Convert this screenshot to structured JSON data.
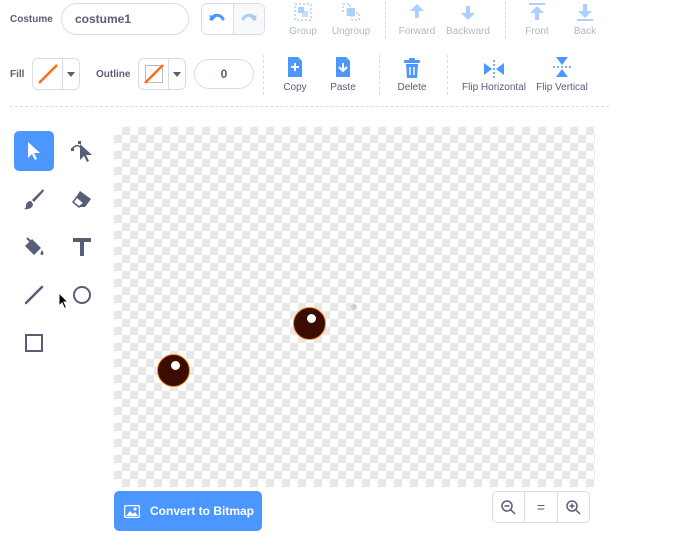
{
  "costume": {
    "label": "Costume",
    "name": "costume1"
  },
  "toolbar": {
    "group": "Group",
    "ungroup": "Ungroup",
    "forward": "Forward",
    "backward": "Backward",
    "front": "Front",
    "back": "Back",
    "copy": "Copy",
    "paste": "Paste",
    "delete": "Delete",
    "flip_horizontal": "Flip Horizontal",
    "flip_vertical": "Flip Vertical"
  },
  "fill": {
    "label": "Fill",
    "color": "#ff6b1a"
  },
  "outline": {
    "label": "Outline",
    "width": "0"
  },
  "tools": [
    {
      "name": "select",
      "icon": "arrow-select-icon",
      "active": true
    },
    {
      "name": "reshape",
      "icon": "reshape-icon",
      "active": false
    },
    {
      "name": "brush",
      "icon": "brush-icon",
      "active": false
    },
    {
      "name": "eraser",
      "icon": "eraser-icon",
      "active": false
    },
    {
      "name": "fill",
      "icon": "paint-bucket-icon",
      "active": false
    },
    {
      "name": "text",
      "icon": "text-icon",
      "active": false
    },
    {
      "name": "line",
      "icon": "line-icon",
      "active": false
    },
    {
      "name": "circle",
      "icon": "circle-icon",
      "active": false
    },
    {
      "name": "rectangle",
      "icon": "rectangle-icon",
      "active": false
    }
  ],
  "bitmap_button": {
    "label": "Convert to Bitmap"
  },
  "zoom": {
    "out": "zoom-out-icon",
    "reset": "=",
    "in": "zoom-in-icon"
  },
  "colors": {
    "accent": "#4c97ff",
    "text": "#575e75",
    "border": "#d9dde3",
    "eye": "#3a0d00",
    "eye_outline": "#ff8a1a"
  }
}
